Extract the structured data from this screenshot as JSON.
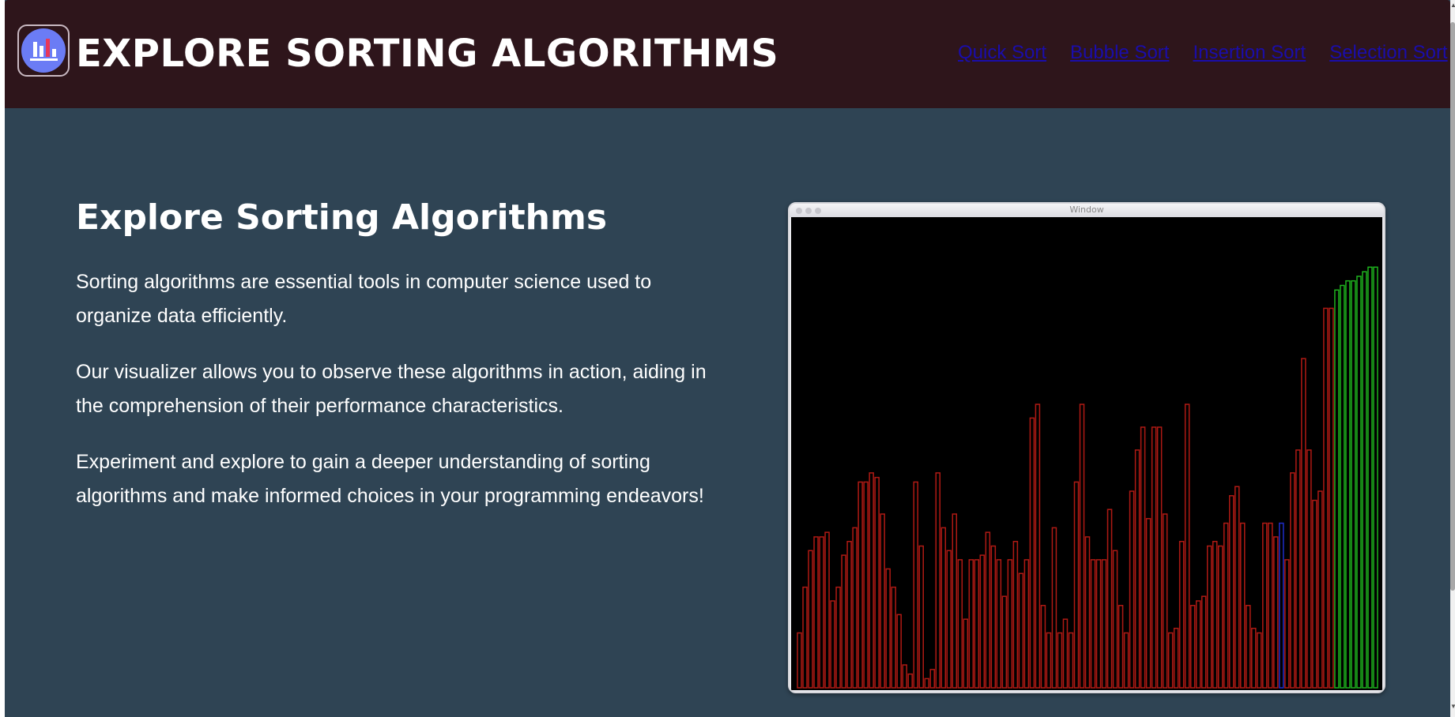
{
  "header": {
    "title": "EXPLORE SORTING ALGORITHMS",
    "nav": [
      "Quick Sort",
      "Bubble Sort",
      "Insertion Sort",
      "Selection Sort"
    ]
  },
  "main": {
    "heading": "Explore Sorting Algorithms",
    "paragraphs": [
      "Sorting algorithms are essential tools in computer science used to organize data efficiently.",
      "Our visualizer allows you to observe these algorithms in action, aiding in the comprehension of their performance characteristics.",
      "Experiment and explore to gain a deeper understanding of sorting algorithms and make informed choices in your programming endeavors!"
    ]
  },
  "visualizer": {
    "window_title": "Window",
    "bars": [
      12,
      22,
      30,
      33,
      33,
      34,
      19,
      22,
      29,
      32,
      35,
      45,
      45,
      47,
      46,
      38,
      26,
      22,
      16,
      5,
      3,
      45,
      31,
      2,
      4,
      47,
      35,
      30,
      38,
      28,
      15,
      28,
      28,
      29,
      34,
      31,
      28,
      20,
      28,
      32,
      25,
      28,
      59,
      62,
      18,
      12,
      35,
      12,
      15,
      12,
      45,
      62,
      33,
      28,
      28,
      28,
      39,
      30,
      18,
      12,
      43,
      52,
      57,
      37,
      57,
      57,
      38,
      12,
      13,
      32,
      62,
      18,
      19,
      20,
      31,
      32,
      31,
      36,
      42,
      44,
      36,
      18,
      13,
      12,
      36,
      36,
      33,
      36,
      28,
      47,
      52,
      72,
      52,
      41,
      43,
      83,
      83,
      87,
      88,
      89,
      89,
      90,
      91,
      92,
      92
    ],
    "bar_states": {
      "red_range": [
        0,
        96
      ],
      "blue_index": 87,
      "green_from": 97
    },
    "colors": {
      "unsorted": "#b01a14",
      "current": "#1f2cc9",
      "sorted": "#1eb31e"
    }
  },
  "colors": {
    "header_bg": "#2e151b",
    "page_bg": "#2f4454",
    "link": "#1a0dab",
    "logo_bg": "#6b7cf5"
  },
  "icons": {
    "logo": "bar-chart-icon"
  }
}
